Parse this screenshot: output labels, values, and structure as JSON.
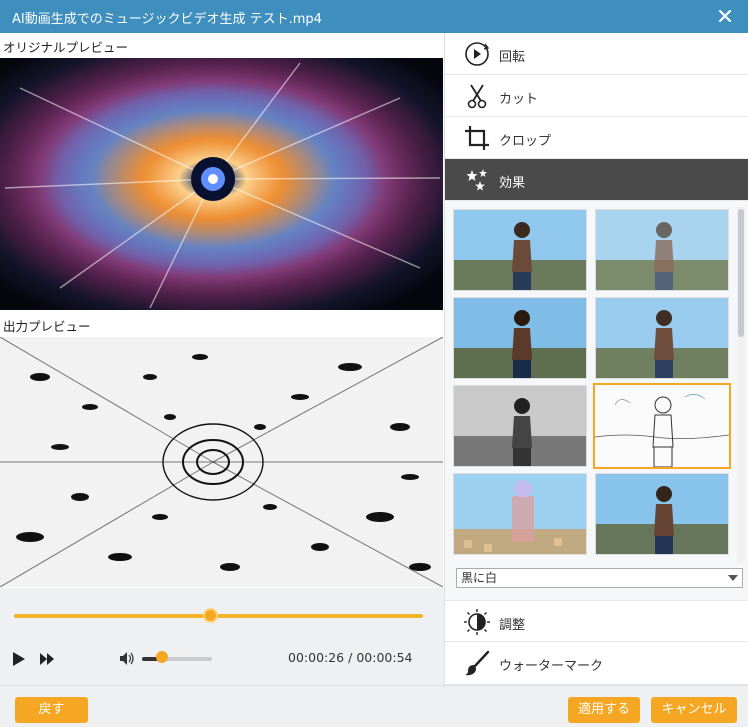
{
  "window": {
    "title": "AI動画生成でのミュージックビデオ生成 テスト.mp4"
  },
  "preview": {
    "original_label": "オリジナルプレビュー",
    "output_label": "出力プレビュー"
  },
  "player": {
    "progress_fraction": 0.48,
    "volume_fraction": 0.28,
    "current_time": "00:00:26",
    "separator": "/",
    "total_time": "00:00:54"
  },
  "sidebar": {
    "items": [
      {
        "label": "回転",
        "icon": "rotate-icon"
      },
      {
        "label": "カット",
        "icon": "scissors-icon"
      },
      {
        "label": "クロップ",
        "icon": "crop-icon"
      },
      {
        "label": "効果",
        "icon": "sparkle-icon",
        "active": true
      }
    ],
    "bottom_items": [
      {
        "label": "調整",
        "icon": "brightness-icon"
      },
      {
        "label": "ウォーターマーク",
        "icon": "brush-icon"
      }
    ]
  },
  "effects": {
    "selected_index": 5,
    "filter_value": "黒に白"
  },
  "footer": {
    "back_label": "戻す",
    "apply_label": "適用する",
    "cancel_label": "キャンセル"
  },
  "colors": {
    "titlebar": "#3e8fbd",
    "accent": "#f5a623",
    "active_menu": "#4a4a4a"
  }
}
